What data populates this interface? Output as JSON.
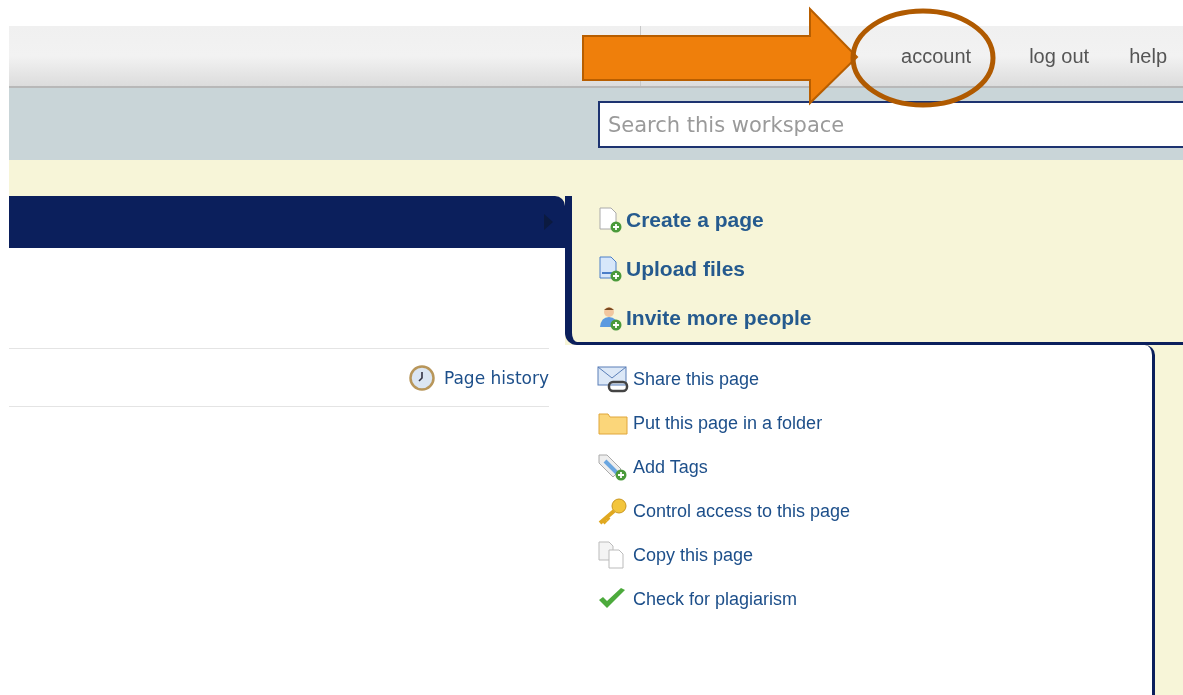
{
  "top_nav": {
    "links": [
      "account",
      "log out",
      "help"
    ]
  },
  "search": {
    "placeholder": "Search this workspace"
  },
  "primary_actions": [
    "Create a page",
    "Upload files",
    "Invite more people"
  ],
  "page_toolbar": {
    "history_link": "Page history"
  },
  "page_actions": [
    "Share this page",
    "Put this page in a folder",
    "Add Tags",
    "Control access to this page",
    "Copy this page",
    "Check for plagiarism"
  ]
}
